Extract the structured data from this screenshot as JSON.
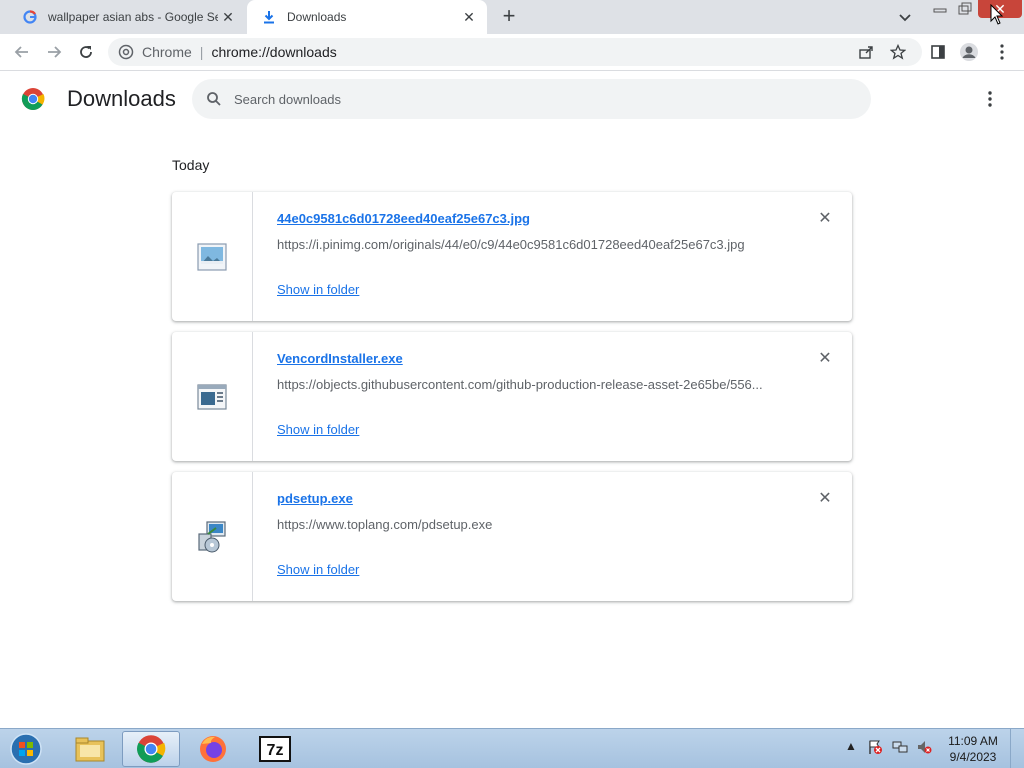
{
  "tabs": [
    {
      "title": "wallpaper asian abs - Google Sea",
      "icon": "google-g-icon",
      "active": false
    },
    {
      "title": "Downloads",
      "icon": "download-icon",
      "active": true
    }
  ],
  "toolbar": {
    "origin": "Chrome",
    "url": "chrome://downloads"
  },
  "page": {
    "title": "Downloads",
    "search_placeholder": "Search downloads",
    "section": "Today"
  },
  "downloads": [
    {
      "filename": "44e0c9581c6d01728eed40eaf25e67c3.jpg",
      "url": "https://i.pinimg.com/originals/44/e0/c9/44e0c9581c6d01728eed40eaf25e67c3.jpg",
      "action": "Show in folder",
      "icon": "image-file-icon"
    },
    {
      "filename": "VencordInstaller.exe",
      "url": "https://objects.githubusercontent.com/github-production-release-asset-2e65be/556...",
      "action": "Show in folder",
      "icon": "exe-file-icon"
    },
    {
      "filename": "pdsetup.exe",
      "url": "https://www.toplang.com/pdsetup.exe",
      "action": "Show in folder",
      "icon": "installer-icon"
    }
  ],
  "taskbar": {
    "apps": [
      "file-explorer-icon",
      "chrome-icon",
      "firefox-icon",
      "7zip-icon"
    ],
    "sevenzip_label": "7z",
    "time": "11:09 AM",
    "date": "9/4/2023"
  },
  "colors": {
    "accent": "#1a73e8",
    "tabstrip": "#dee1e6",
    "close": "#c8453a"
  }
}
